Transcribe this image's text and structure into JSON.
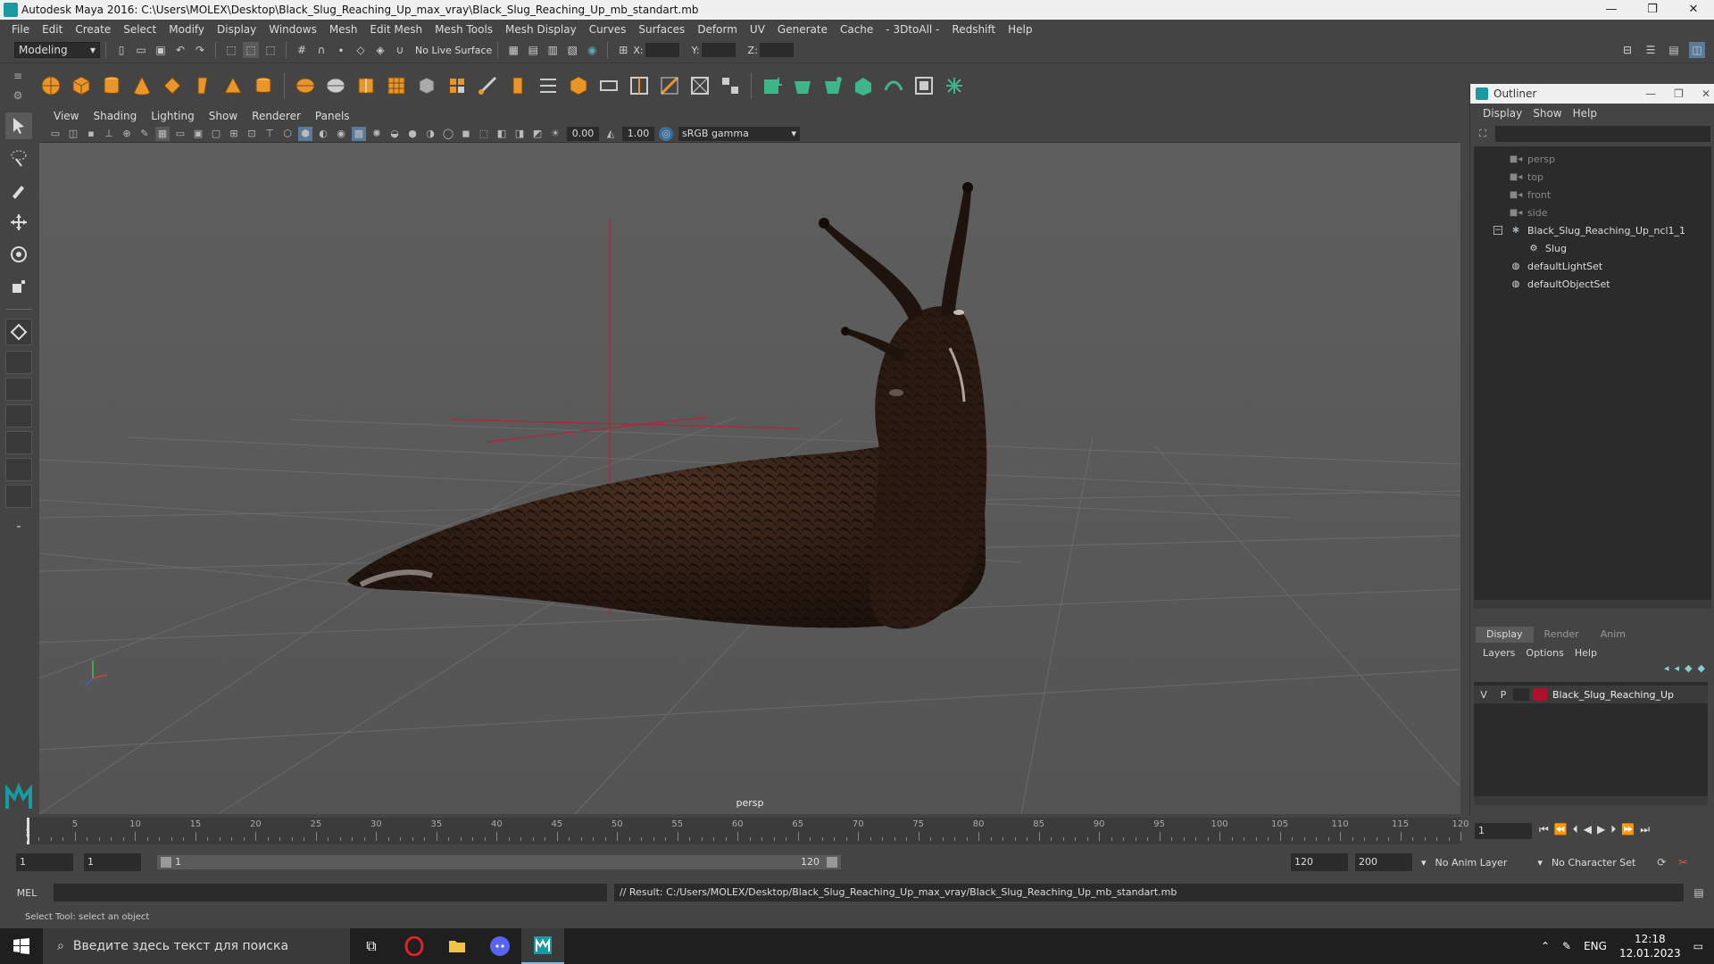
{
  "window": {
    "title": "Autodesk Maya 2016: C:\\Users\\MOLEX\\Desktop\\Black_Slug_Reaching_Up_max_vray\\Black_Slug_Reaching_Up_mb_standart.mb",
    "minimize": "—",
    "maximize": "❐",
    "close": "✕"
  },
  "menubar": [
    "File",
    "Edit",
    "Create",
    "Select",
    "Modify",
    "Display",
    "Windows",
    "Mesh",
    "Edit Mesh",
    "Mesh Tools",
    "Mesh Display",
    "Curves",
    "Surfaces",
    "Deform",
    "UV",
    "Generate",
    "Cache",
    "- 3DtoAll -",
    "Redshift",
    "Help"
  ],
  "statusline": {
    "mode": "Modeling",
    "live_surface": "No Live Surface",
    "x_label": "X:",
    "y_label": "Y:",
    "z_label": "Z:"
  },
  "viewport": {
    "menu": [
      "View",
      "Shading",
      "Lighting",
      "Show",
      "Renderer",
      "Panels"
    ],
    "exposure": "0.00",
    "gamma_value": "1.00",
    "color_space": "sRGB gamma",
    "camera_label": "persp"
  },
  "outliner": {
    "title": "Outliner",
    "menu": [
      "Display",
      "Show",
      "Help"
    ],
    "items": [
      {
        "label": "persp",
        "icon": "camera-icon",
        "dim": true
      },
      {
        "label": "top",
        "icon": "camera-icon",
        "dim": true
      },
      {
        "label": "front",
        "icon": "camera-icon",
        "dim": true
      },
      {
        "label": "side",
        "icon": "camera-icon",
        "dim": true
      },
      {
        "label": "Black_Slug_Reaching_Up_ncl1_1",
        "icon": "group-icon",
        "dim": false
      },
      {
        "label": "Slug",
        "icon": "mesh-icon",
        "dim": false
      },
      {
        "label": "defaultLightSet",
        "icon": "set-icon",
        "dim": false
      },
      {
        "label": "defaultObjectSet",
        "icon": "set-icon",
        "dim": false
      }
    ]
  },
  "layer_editor": {
    "tabs": [
      "Display",
      "Render",
      "Anim"
    ],
    "menu": [
      "Layers",
      "Options",
      "Help"
    ],
    "layer": {
      "v": "V",
      "p": "P",
      "name": "Black_Slug_Reaching_Up",
      "color": "#b0102a"
    }
  },
  "timeslider": {
    "ticks": [
      "5",
      "10",
      "15",
      "20",
      "25",
      "30",
      "35",
      "40",
      "45",
      "50",
      "55",
      "60",
      "65",
      "70",
      "75",
      "80",
      "85",
      "90",
      "95",
      "100",
      "105",
      "110",
      "115",
      "120"
    ],
    "current_frame_marker": "1",
    "current_frame": "1"
  },
  "rangeslider": {
    "start": "1",
    "playback_start": "1",
    "bar_start": "1",
    "bar_end": "120",
    "playback_end": "120",
    "end": "200",
    "anim_layer": "No Anim Layer",
    "character_set": "No Character Set"
  },
  "cmdline": {
    "label": "MEL",
    "result": "// Result: C:/Users/MOLEX/Desktop/Black_Slug_Reaching_Up_max_vray/Black_Slug_Reaching_Up_mb_standart.mb"
  },
  "helpline": "Select Tool: select an object",
  "taskbar": {
    "search_placeholder": "Введите здесь текст для поиска",
    "lang": "ENG",
    "time": "12:18",
    "date": "12.01.2023"
  },
  "colors": {
    "maya_teal": "#1a9aa0",
    "shelf_orange": "#e8962a",
    "shelf_green": "#3fb58a",
    "slug_body": "#2a1a12",
    "layer_red": "#b0102a"
  }
}
